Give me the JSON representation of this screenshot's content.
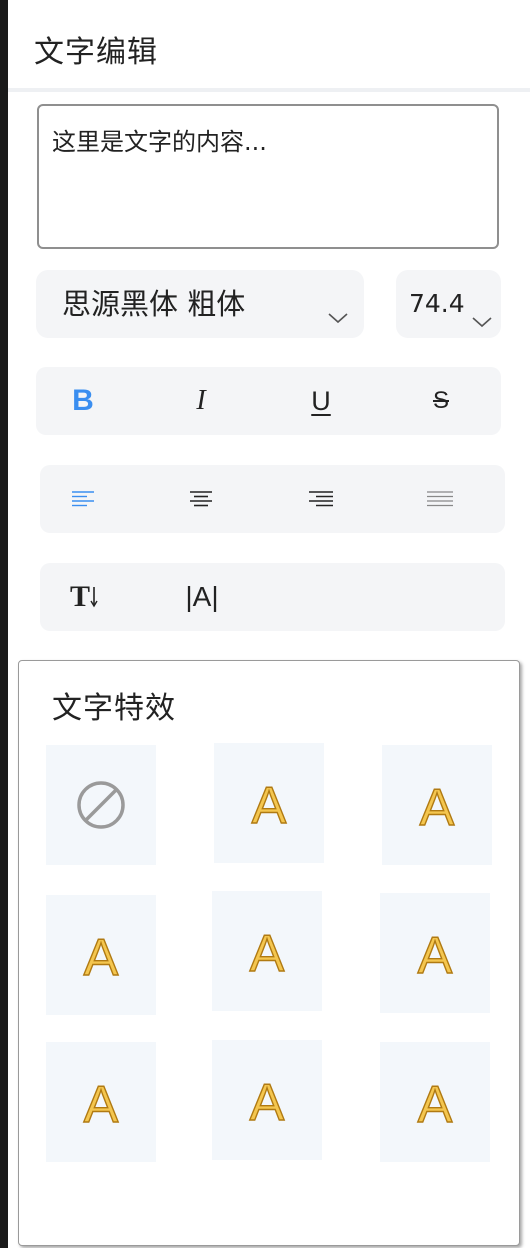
{
  "header": {
    "title": "文字编辑"
  },
  "text_input": {
    "value": "这里是文字的内容..."
  },
  "font": {
    "family": "思源黑体 粗体",
    "size": "74.4"
  },
  "style_toolbar": [
    {
      "name": "bold",
      "glyph": "B",
      "active": true
    },
    {
      "name": "italic",
      "glyph": "I",
      "active": false
    },
    {
      "name": "underline",
      "glyph": "U",
      "active": false
    },
    {
      "name": "strikethrough",
      "glyph": "S",
      "active": false
    }
  ],
  "align_toolbar": [
    {
      "name": "align-left",
      "active": true
    },
    {
      "name": "align-center",
      "active": false
    },
    {
      "name": "align-right",
      "active": false
    },
    {
      "name": "align-justify",
      "active": false
    }
  ],
  "direction_toolbar": [
    {
      "name": "vertical-text",
      "glyph": "T"
    },
    {
      "name": "letter-spacing",
      "glyph": "|A|"
    }
  ],
  "effects": {
    "title": "文字特效",
    "items": [
      {
        "icon": "none-icon"
      },
      {
        "icon": "letter-a-icon",
        "glyph": "A"
      },
      {
        "icon": "letter-a-icon",
        "glyph": "A"
      },
      {
        "icon": "letter-a-icon",
        "glyph": "A"
      },
      {
        "icon": "letter-a-icon",
        "glyph": "A"
      },
      {
        "icon": "letter-a-icon",
        "glyph": "A"
      },
      {
        "icon": "letter-a-icon",
        "glyph": "A"
      },
      {
        "icon": "letter-a-icon",
        "glyph": "A"
      },
      {
        "icon": "letter-a-icon",
        "glyph": "A"
      }
    ]
  },
  "colors": {
    "accent": "#3a8ef0",
    "panel_bg": "#f4f5f7",
    "tile_bg": "#f3f7fb",
    "effect_fill": "#f4c64f",
    "effect_stroke": "#b07a12"
  }
}
